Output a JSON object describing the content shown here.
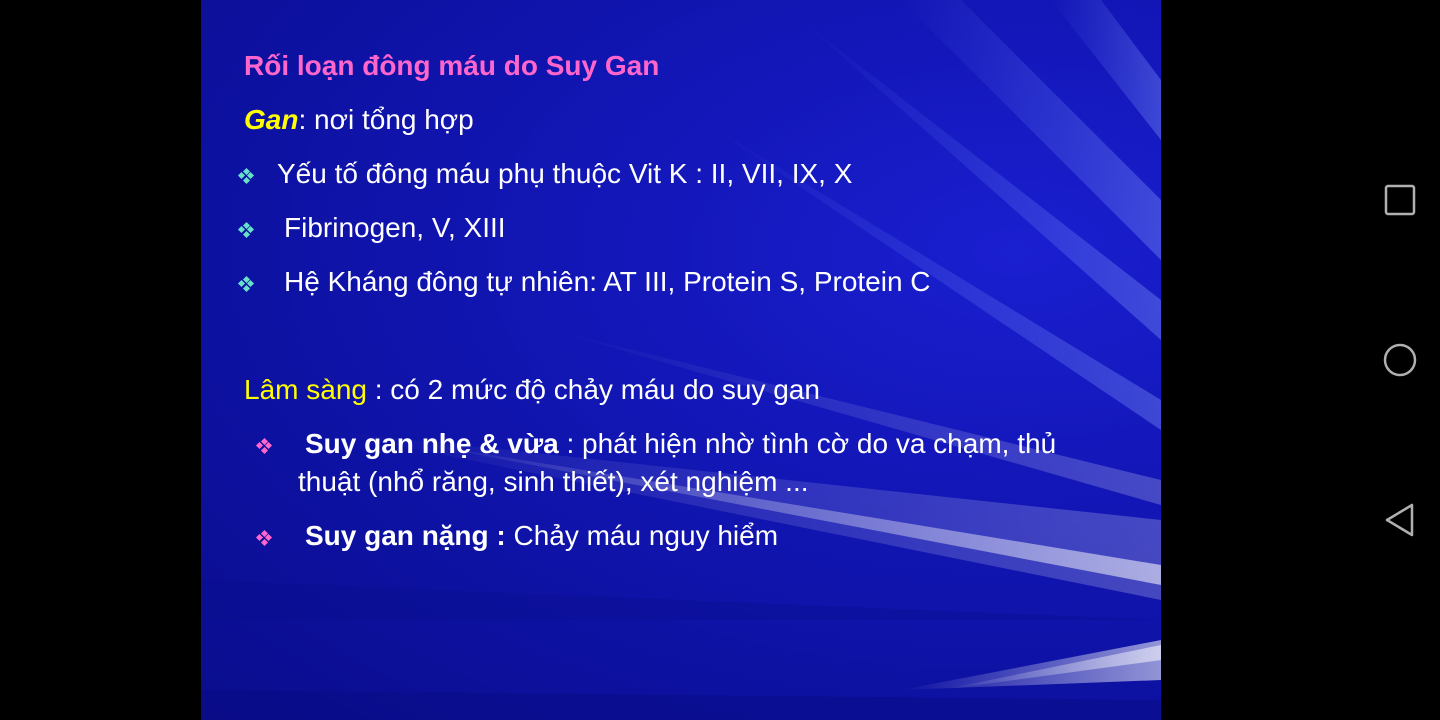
{
  "slide": {
    "title": "Rối loạn đông máu do Suy Gan",
    "gan_word": "Gan",
    "gan_rest": ": nơi tổng hợp",
    "bullets": [
      "Yếu tố đông máu phụ thuộc Vit K : II, VII, IX, X",
      "Fibrinogen, V, XIII",
      "Hệ Kháng đông tự nhiên: AT III, Protein S, Protein C"
    ],
    "clinical_label": "Lâm sàng",
    "clinical_rest": " : có 2 mức độ chảy máu do suy gan",
    "sub_bullets": [
      {
        "bold": "Suy gan nhẹ & vừa",
        "text": " : phát hiện nhờ tình cờ do va chạm, thủ",
        "continuation": "thuật (nhổ răng, sinh thiết), xét nghiệm ..."
      },
      {
        "bold": "Suy gan nặng :",
        "text": " Chảy máu nguy hiểm",
        "continuation": ""
      }
    ],
    "colors": {
      "background": "#1317b8",
      "title": "#ff66cc",
      "highlight": "#ffff00",
      "bullet_teal": "#66e0c8",
      "bullet_pink": "#ff66cc",
      "text": "#ffffff"
    }
  },
  "navigation": {
    "recents_icon": "square-icon",
    "home_icon": "circle-icon",
    "back_icon": "triangle-back-icon"
  }
}
